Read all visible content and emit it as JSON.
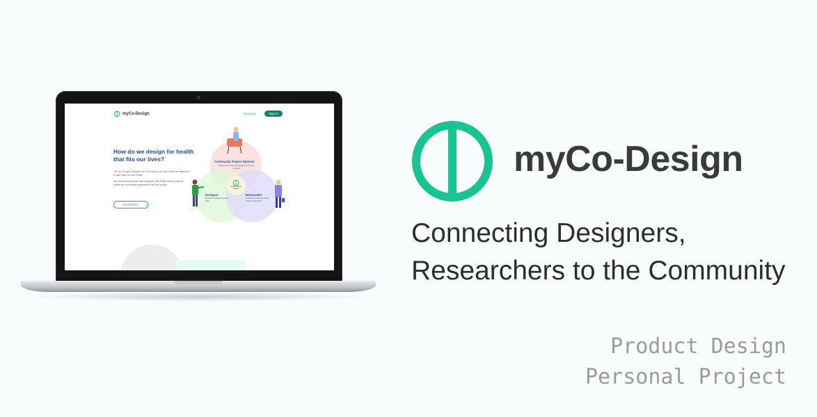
{
  "screen": {
    "logo": {
      "text": "myCo-Design"
    },
    "nav": {
      "join": "Join now",
      "signin": "Sign in"
    },
    "hero": {
      "title": "How do we design for health that fits our lives?",
      "p1": "The aim of myCo-Design is to re-introduce our voice back into healthcare to take back our own health.",
      "p2": "We connect researchers and designers with health related projects posted by community organizations and non-profits.",
      "read_more": "Read More"
    },
    "venn": {
      "sponsor": {
        "title": "Community Project Sponsor",
        "desc": "Experience creating and applying community programs"
      },
      "designer": {
        "title": "Designer",
        "desc": "Breadth of design & interview skills"
      },
      "researcher": {
        "title": "Researcher",
        "desc": "Academic & evidence based research experience"
      },
      "hub": "myCo-Design Project"
    },
    "colors": {
      "sponsor": "#fde0e0",
      "designer": "#def8d8",
      "researcher": "#dedcfb",
      "center": "#fbf7d6",
      "accent": "#19b38a",
      "title_blue": "#1e4c99"
    }
  },
  "brand": {
    "name": "myCo-Design",
    "mark_color": "#19c394",
    "tagline_line1": "Connecting Designers,",
    "tagline_line2": "Researchers to the Community"
  },
  "meta": {
    "line1": "Product Design",
    "line2": "Personal Project"
  }
}
